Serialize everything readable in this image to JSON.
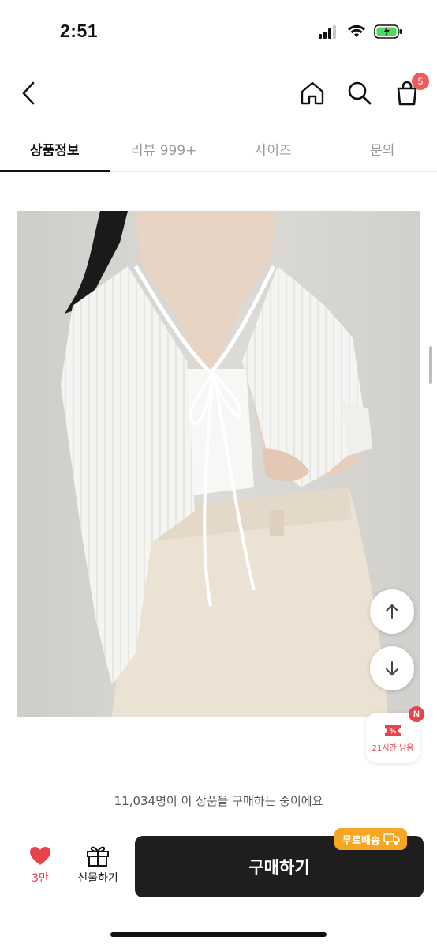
{
  "status_bar": {
    "time": "2:51"
  },
  "header": {
    "cart_count": "5"
  },
  "tabs": [
    {
      "label": "상품정보",
      "active": true
    },
    {
      "label": "리뷰 999+",
      "active": false
    },
    {
      "label": "사이즈",
      "active": false
    },
    {
      "label": "문의",
      "active": false
    }
  ],
  "floating": {
    "coupon_label": "21시간 남음",
    "coupon_badge": "N"
  },
  "buyers_text": "11,034명이 이 상품을 구매하는 중이에요",
  "bottom": {
    "like_count": "3만",
    "gift_label": "선물하기",
    "buy_label": "구매하기",
    "free_shipping": "무료배송"
  },
  "colors": {
    "accent_red": "#e8434b",
    "badge_orange": "#f6a623",
    "buy_button": "#1e1e1e"
  }
}
